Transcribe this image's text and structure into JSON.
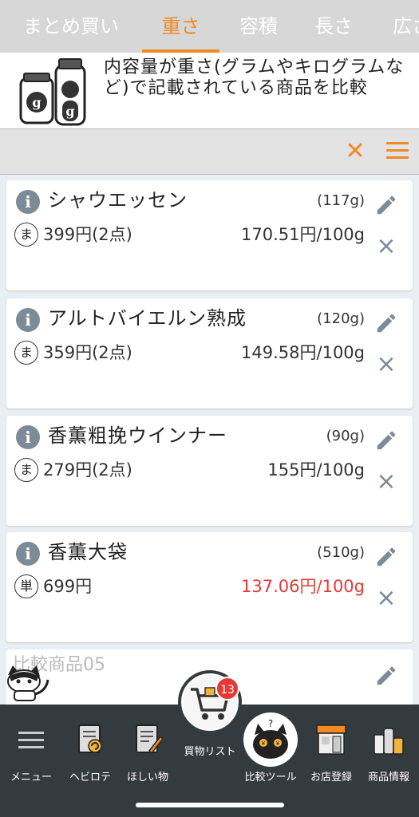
{
  "tabs": [
    "まとめ買い",
    "重さ",
    "容積",
    "長さ",
    "広さ"
  ],
  "active_tab": "重さ",
  "description": "内容量が重さ(グラムやキログラムなど)で記載されている商品を比較",
  "toolbar": {
    "close_icon": "close-icon",
    "menu_icon": "hamburger-icon"
  },
  "products": [
    {
      "name": "シャウエッセン",
      "weight": "(117g)",
      "badge": "ま",
      "price": "399円(2点)",
      "unit_price": "170.51円/100g",
      "best": false
    },
    {
      "name": "アルトバイエルン熟成",
      "weight": "(120g)",
      "badge": "ま",
      "price": "359円(2点)",
      "unit_price": "149.58円/100g",
      "best": false
    },
    {
      "name": "香薫粗挽ウインナー",
      "weight": "(90g)",
      "badge": "ま",
      "price": "279円(2点)",
      "unit_price": "155円/100g",
      "best": false
    },
    {
      "name": "香薫大袋",
      "weight": "(510g)",
      "badge": "単",
      "price": "699円",
      "unit_price": "137.06円/100g",
      "best": true
    }
  ],
  "placeholder": "比較商品05",
  "colors": {
    "accent": "#f08a24",
    "best": "#e53935",
    "bar": "#343b3f"
  },
  "bottom_nav": {
    "menu": "メニュー",
    "heavy": "ヘビロテ",
    "wish": "ほしい物",
    "cart": "買物リスト",
    "cart_count": "13",
    "compare": "比較ツール",
    "store": "お店登録",
    "product": "商品情報"
  }
}
